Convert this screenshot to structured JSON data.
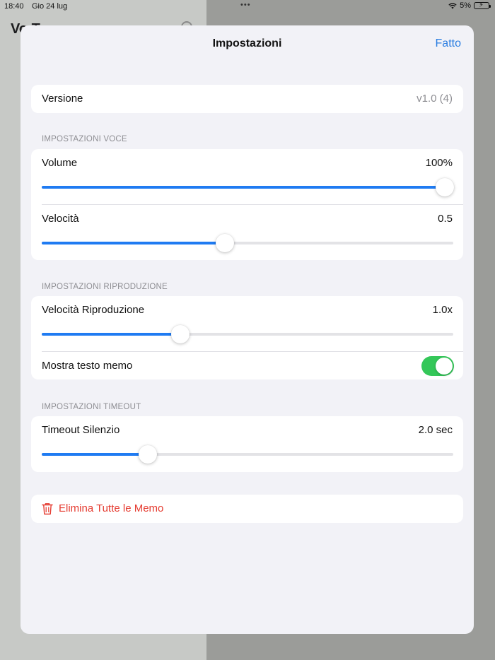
{
  "status_bar": {
    "time": "18:40",
    "date": "Gio 24 lug",
    "dots": "•••",
    "battery": "5%"
  },
  "background_app": {
    "title": "Vo T"
  },
  "nav": {
    "title": "Impostazioni",
    "done_label": "Fatto"
  },
  "version_row": {
    "label": "Versione",
    "value": "v1.0 (4)"
  },
  "voice_section": {
    "header": "IMPOSTAZIONI VOCE",
    "volume": {
      "label": "Volume",
      "value_text": "100%",
      "fraction": 0.98
    },
    "speed": {
      "label": "Velocità",
      "value_text": "0.5",
      "fraction": 0.445
    }
  },
  "playback_section": {
    "header": "IMPOSTAZIONI RIPRODUZIONE",
    "playback_speed": {
      "label": "Velocità Riproduzione",
      "value_text": "1.0x",
      "fraction": 0.337
    },
    "show_memo_text": {
      "label": "Mostra testo memo",
      "on": true
    }
  },
  "timeout_section": {
    "header": "IMPOSTAZIONI TIMEOUT",
    "silence_timeout": {
      "label": "Timeout Silenzio",
      "value_text": "2.0 sec",
      "fraction": 0.258
    }
  },
  "delete_all": {
    "label": "Elimina Tutte le Memo"
  },
  "colors": {
    "accent": "#1f7bf2",
    "toggle_on": "#34c759",
    "destructive": "#e53b30",
    "background": "#f2f2f7"
  },
  "icons": {
    "delete": "trash-icon",
    "settings": "gear-icon"
  }
}
